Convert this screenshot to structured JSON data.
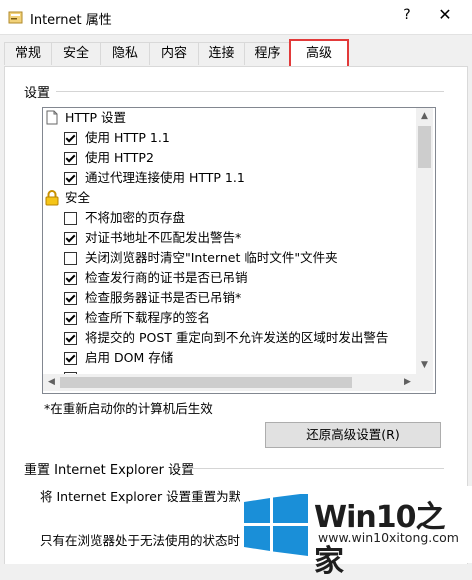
{
  "window": {
    "title": "Internet 属性",
    "help_label": "?",
    "close_label": "✕"
  },
  "tabs": [
    {
      "label": "常规"
    },
    {
      "label": "安全"
    },
    {
      "label": "隐私"
    },
    {
      "label": "内容"
    },
    {
      "label": "连接"
    },
    {
      "label": "程序"
    },
    {
      "label": "高级",
      "selected": true
    }
  ],
  "settings": {
    "group_label": "设置",
    "items": [
      {
        "type": "category",
        "icon": "document-icon",
        "label": "HTTP 设置"
      },
      {
        "type": "checkbox",
        "checked": true,
        "label": "使用 HTTP 1.1"
      },
      {
        "type": "checkbox",
        "checked": true,
        "label": "使用 HTTP2"
      },
      {
        "type": "checkbox",
        "checked": true,
        "label": "通过代理连接使用 HTTP 1.1"
      },
      {
        "type": "category",
        "icon": "lock-icon",
        "label": "安全"
      },
      {
        "type": "checkbox",
        "checked": false,
        "label": "不将加密的页存盘"
      },
      {
        "type": "checkbox",
        "checked": true,
        "label": "对证书地址不匹配发出警告*"
      },
      {
        "type": "checkbox",
        "checked": false,
        "label": "关闭浏览器时清空\"Internet 临时文件\"文件夹"
      },
      {
        "type": "checkbox",
        "checked": true,
        "label": "检查发行商的证书是否已吊销"
      },
      {
        "type": "checkbox",
        "checked": true,
        "label": "检查服务器证书是否已吊销*"
      },
      {
        "type": "checkbox",
        "checked": true,
        "label": "检查所下载程序的签名"
      },
      {
        "type": "checkbox",
        "checked": true,
        "label": "将提交的 POST 重定向到不允许发送的区域时发出警告"
      },
      {
        "type": "checkbox",
        "checked": true,
        "label": "启用 DOM 存储"
      }
    ],
    "note": "*在重新启动你的计算机后生效",
    "restore_button": "还原高级设置(R)"
  },
  "reset": {
    "group_label": "重置 Internet Explorer 设置",
    "desc1": "将 Internet Explorer 设置重置为默认",
    "desc2": "只有在浏览器处于无法使用的状态时，"
  },
  "watermark": {
    "brand": "Win10之家",
    "url": "www.win10xitong.com"
  },
  "colors": {
    "active_tab_border": "#e23a3a",
    "win_logo_blue": "#1a8fd8"
  }
}
